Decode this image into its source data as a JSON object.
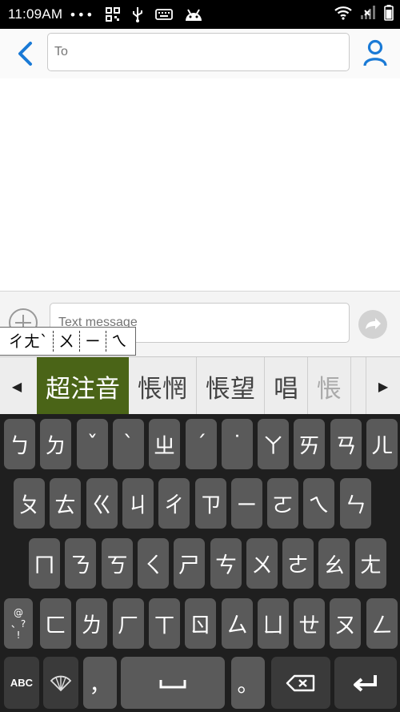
{
  "status_bar": {
    "time": "11:09AM",
    "dots": "•••"
  },
  "header": {
    "to_placeholder": "To"
  },
  "compose": {
    "message_placeholder": "Text message"
  },
  "composing": {
    "segments": [
      "ㄔㄤˋ",
      "ㄨ",
      "ㄧ",
      "ㄟ"
    ]
  },
  "candidates": {
    "items": [
      "超注音",
      "悵惘",
      "悵望",
      "唱",
      "悵"
    ],
    "selected_index": 0
  },
  "keyboard": {
    "row1": [
      "ㄅ",
      "ㄉ",
      "ˇ",
      "ˋ",
      "ㄓ",
      "ˊ",
      "˙",
      "ㄚ",
      "ㄞ",
      "ㄢ",
      "ㄦ"
    ],
    "row2": [
      "ㄆ",
      "ㄊ",
      "ㄍ",
      "ㄐ",
      "ㄔ",
      "ㄗ",
      "ㄧ",
      "ㄛ",
      "ㄟ",
      "ㄣ"
    ],
    "row3": [
      "ㄇ",
      "ㄋ",
      "ㄎ",
      "ㄑ",
      "ㄕ",
      "ㄘ",
      "ㄨ",
      "ㄜ",
      "ㄠ",
      "ㄤ"
    ],
    "row4": [
      "ㄈ",
      "ㄌ",
      "ㄏ",
      "ㄒ",
      "ㄖ",
      "ㄙ",
      "ㄩ",
      "ㄝ",
      "ㄡ",
      "ㄥ"
    ],
    "symbol_key": "@ 、? !",
    "abc_key": "ABC",
    "comma_key": "，",
    "period_key": "。"
  }
}
